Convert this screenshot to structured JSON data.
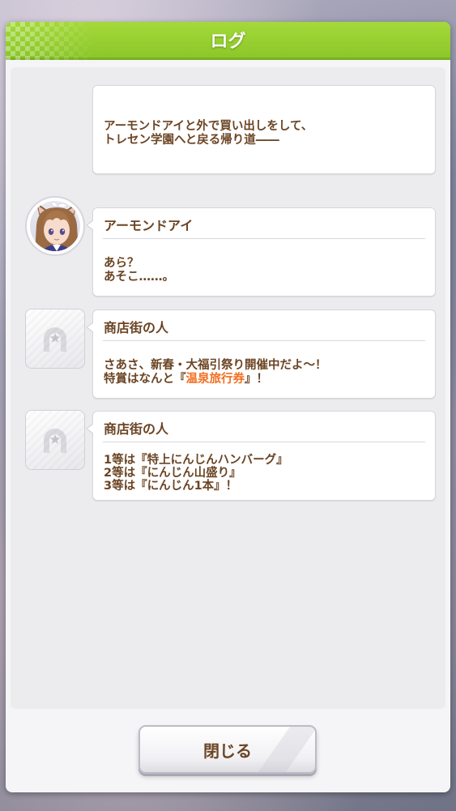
{
  "dialog": {
    "title": "ログ"
  },
  "log": [
    {
      "speaker": "",
      "lines": [
        [
          "アーモンドアイと外で買い出しをして、"
        ],
        [
          "トレセン学園へと戻る帰り道――"
        ]
      ]
    },
    {
      "speaker": "アーモンドアイ",
      "avatar": "character-portrait",
      "lines": [
        [
          "あら？"
        ],
        [
          "あそこ……。"
        ]
      ]
    },
    {
      "speaker": "商店街の人",
      "avatar": "horseshoe-placeholder-icon",
      "lines": [
        [
          "さあさ、新春・大福引祭り開催中だよ～！"
        ],
        [
          "特賞はなんと『",
          "温泉旅行券",
          "』！"
        ]
      ],
      "highlight_color": "#f26d1f"
    },
    {
      "speaker": "商店街の人",
      "avatar": "horseshoe-placeholder-icon",
      "lines": [
        [
          "1等は『特上にんじんハンバーグ』"
        ],
        [
          "2等は『にんじん山盛り』"
        ],
        [
          "3等は『にんじん1本』！"
        ]
      ]
    }
  ],
  "footer": {
    "close_label": "閉じる"
  },
  "colors": {
    "header_green": "#8cc72a",
    "text_brown": "#6b4423",
    "highlight_orange": "#f26d1f"
  }
}
